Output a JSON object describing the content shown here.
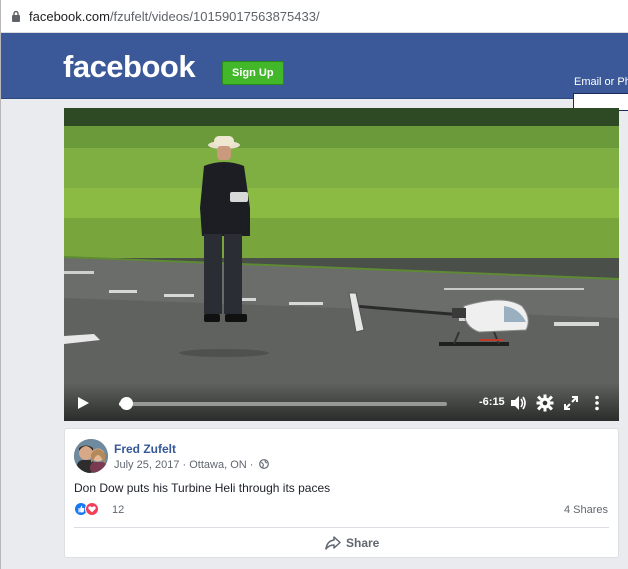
{
  "browser": {
    "url_host": "facebook.com",
    "url_path": "/fzufelt/videos/10159017563875433/"
  },
  "header": {
    "logo_text": "facebook",
    "signup_label": "Sign Up",
    "email_label": "Email or Phone",
    "brand_color": "#3b5998"
  },
  "video": {
    "time_remaining": "-6:15",
    "progress_fraction": 0.02,
    "controls": [
      "play-icon",
      "volume-icon",
      "settings-icon",
      "fullscreen-icon",
      "more-icon"
    ]
  },
  "post": {
    "author": "Fred Zufelt",
    "date": "July 25, 2017",
    "location": "Ottawa, ON",
    "separator": "·",
    "text": "Don Dow puts his Turbine Heli through its paces",
    "reaction_count": "12",
    "shares": "4 Shares",
    "share_label": "Share"
  }
}
